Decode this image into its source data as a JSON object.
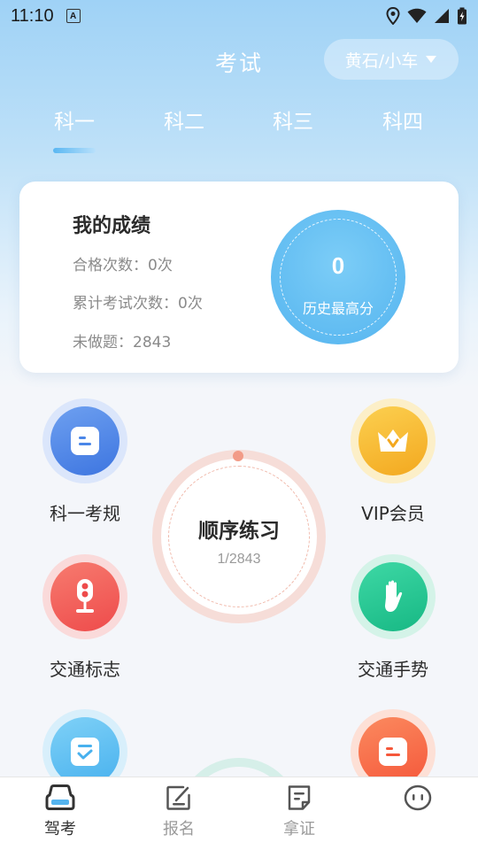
{
  "status_bar": {
    "time": "11:10",
    "notification_badge": "A"
  },
  "header": {
    "title": "考试",
    "region": "黄石/小车"
  },
  "tabs": [
    {
      "label": "科一",
      "active": true
    },
    {
      "label": "科二",
      "active": false
    },
    {
      "label": "科三",
      "active": false
    },
    {
      "label": "科四",
      "active": false
    }
  ],
  "score_card": {
    "title": "我的成绩",
    "passed": "合格次数：0次",
    "total_exams": "累计考试次数：0次",
    "unanswered": "未做题：2843",
    "best_score": "0",
    "best_score_label": "历史最高分"
  },
  "features": {
    "rules": "科一考规",
    "vip": "VIP会员",
    "signs": "交通标志",
    "gestures": "交通手势"
  },
  "practice": {
    "title": "顺序练习",
    "progress": "1/2843"
  },
  "bottom_nav": [
    {
      "label": "驾考",
      "icon": "car-icon",
      "active": true
    },
    {
      "label": "报名",
      "icon": "edit-icon",
      "active": false
    },
    {
      "label": "拿证",
      "icon": "license-icon",
      "active": false
    },
    {
      "label": "",
      "icon": "face-icon",
      "active": false
    }
  ],
  "colors": {
    "accent_blue": "#54b4ef",
    "rules_blue": "#4a86e8",
    "vip_yellow": "#f7b72c",
    "signs_red": "#f05a5a",
    "gestures_green": "#25c48f",
    "checklist_blue": "#5bc0f2",
    "orange": "#f66a45"
  }
}
